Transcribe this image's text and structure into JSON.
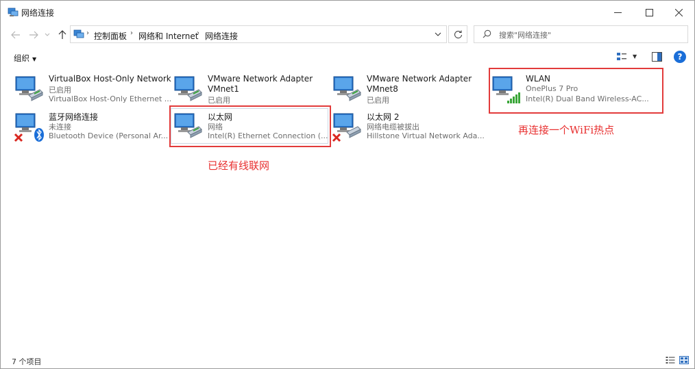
{
  "window": {
    "title": "网络连接",
    "minimize_glyph": "—",
    "maximize_glyph": "☐",
    "close_glyph": "✕"
  },
  "nav": {
    "back_icon": "left-arrow-icon",
    "forward_icon": "right-arrow-icon",
    "recent_icon": "chevron-down-icon",
    "up_icon": "up-arrow-icon"
  },
  "breadcrumb": {
    "items": [
      "控制面板",
      "网络和 Internet",
      "网络连接"
    ]
  },
  "search": {
    "placeholder": "搜索\"网络连接\""
  },
  "toolbar": {
    "organize_label": "组织",
    "help_label": "?"
  },
  "items": [
    {
      "name": "VirtualBox Host-Only Network",
      "status": "已启用",
      "device": "VirtualBox Host-Only Ethernet ..."
    },
    {
      "name": "VMware Network Adapter VMnet1",
      "status": "已启用",
      "device": ""
    },
    {
      "name": "VMware Network Adapter VMnet8",
      "status": "已启用",
      "device": ""
    },
    {
      "name": "WLAN",
      "status": "OnePlus 7 Pro",
      "device": "Intel(R) Dual Band Wireless-AC..."
    },
    {
      "name": "蓝牙网络连接",
      "status": "未连接",
      "device": "Bluetooth Device (Personal Ar..."
    },
    {
      "name": "以太网",
      "status": "网络",
      "device": "Intel(R) Ethernet Connection (..."
    },
    {
      "name": "以太网 2",
      "status": "网络电缆被拔出",
      "device": "Hillstone Virtual Network Ada..."
    }
  ],
  "annotations": {
    "ethernet_note": "已经有线联网",
    "wifi_note": "再连接一个WiFi热点"
  },
  "statusbar": {
    "count_text": "7 个项目"
  },
  "colors": {
    "annotation_red": "#e23a3a",
    "accent_blue": "#1a6ed8",
    "signal_green": "#3aa639",
    "error_red": "#d9271f"
  }
}
